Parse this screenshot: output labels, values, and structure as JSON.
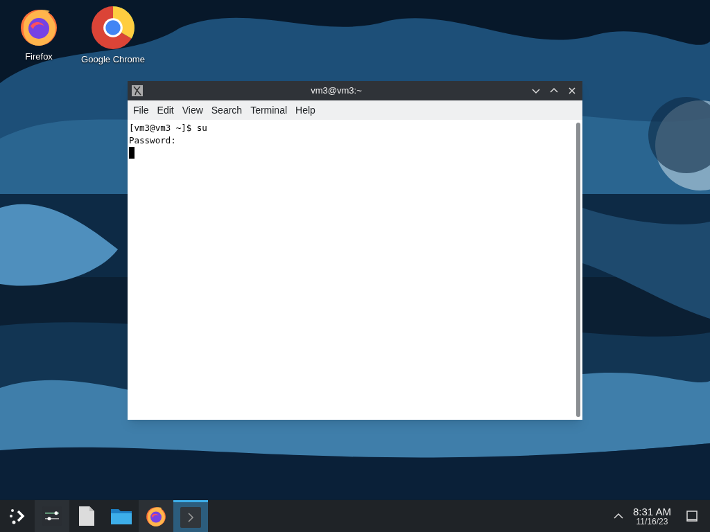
{
  "desktop_icons": [
    {
      "kind": "firefox",
      "label": "Firefox"
    },
    {
      "kind": "chrome",
      "label": "Google Chrome"
    }
  ],
  "window": {
    "title": "vm3@vm3:~",
    "menu": [
      "File",
      "Edit",
      "View",
      "Search",
      "Terminal",
      "Help"
    ],
    "lines": [
      "[vm3@vm3 ~]$ su",
      "Password:"
    ],
    "cursor": true
  },
  "taskbar": {
    "items": [
      {
        "kind": "launcher",
        "selected": false
      },
      {
        "kind": "settings",
        "selected": false
      },
      {
        "kind": "file",
        "selected": false
      },
      {
        "kind": "folder",
        "selected": false
      },
      {
        "kind": "firefox",
        "selected": false
      },
      {
        "kind": "terminal",
        "selected": true
      }
    ],
    "time": "8:31 AM",
    "date": "11/16/23"
  }
}
